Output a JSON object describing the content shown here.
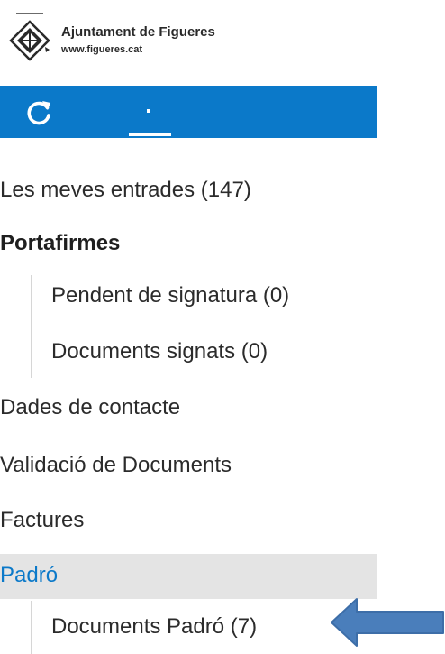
{
  "header": {
    "org_name": "Ajuntament de Figueres",
    "org_url": "www.figueres.cat",
    "logo_icon": "figueres-crest-icon"
  },
  "toolbar": {
    "color": "#0b79c9",
    "refresh_icon": "refresh-icon"
  },
  "menu": {
    "my_entries": "Les meves entrades (147)",
    "portafirmes_heading": "Portafirmes",
    "pending_signature": "Pendent de signatura (0)",
    "signed_documents": "Documents signats (0)",
    "contact_data": "Dades de contacte",
    "document_validation": "Validació de Documents",
    "invoices": "Factures",
    "padro_heading": "Padró",
    "padro_documents": "Documents Padró (7)"
  },
  "annotation": {
    "arrow_icon": "left-arrow-icon",
    "arrow_color": "#4a7ebb"
  }
}
